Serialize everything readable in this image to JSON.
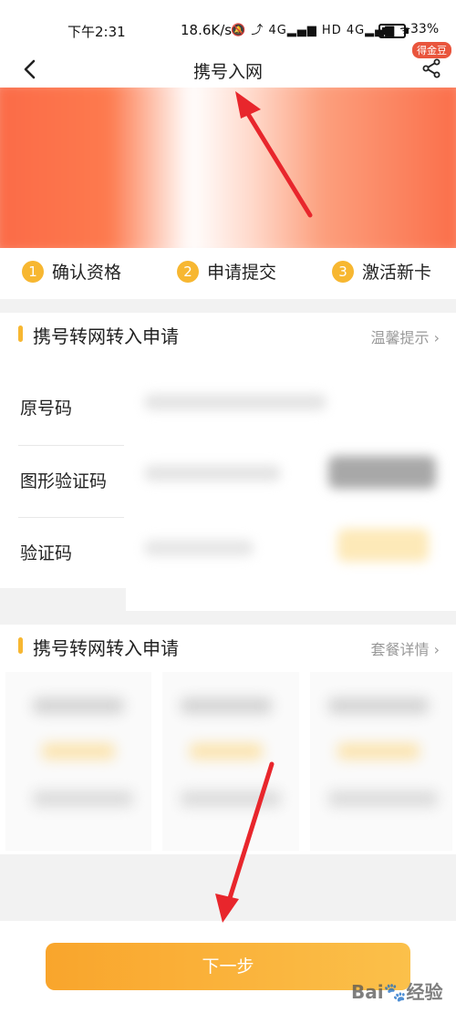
{
  "status_bar": {
    "time": "下午2:31",
    "speed": "18.6K/s",
    "network_icons": "🔕 ⤴ 4G▂▄▆ HD 4G▂▄▆ ᯤ",
    "battery": "33%"
  },
  "nav": {
    "title": "携号入网",
    "badge": "得金豆"
  },
  "steps": [
    {
      "num": "1",
      "label": "确认资格"
    },
    {
      "num": "2",
      "label": "申请提交"
    },
    {
      "num": "3",
      "label": "激活新卡"
    }
  ],
  "section1": {
    "title": "携号转网转入申请",
    "link": "温馨提示",
    "rows": [
      "原号码",
      "图形验证码",
      "验证码"
    ]
  },
  "section2": {
    "title": "携号转网转入申请",
    "link": "套餐详情"
  },
  "footer": {
    "next_label": "下一步",
    "watermark": "Bai🐾经验"
  },
  "colors": {
    "accent": "#f7b731",
    "badge": "#e9553d",
    "arrow": "#e8262c"
  }
}
